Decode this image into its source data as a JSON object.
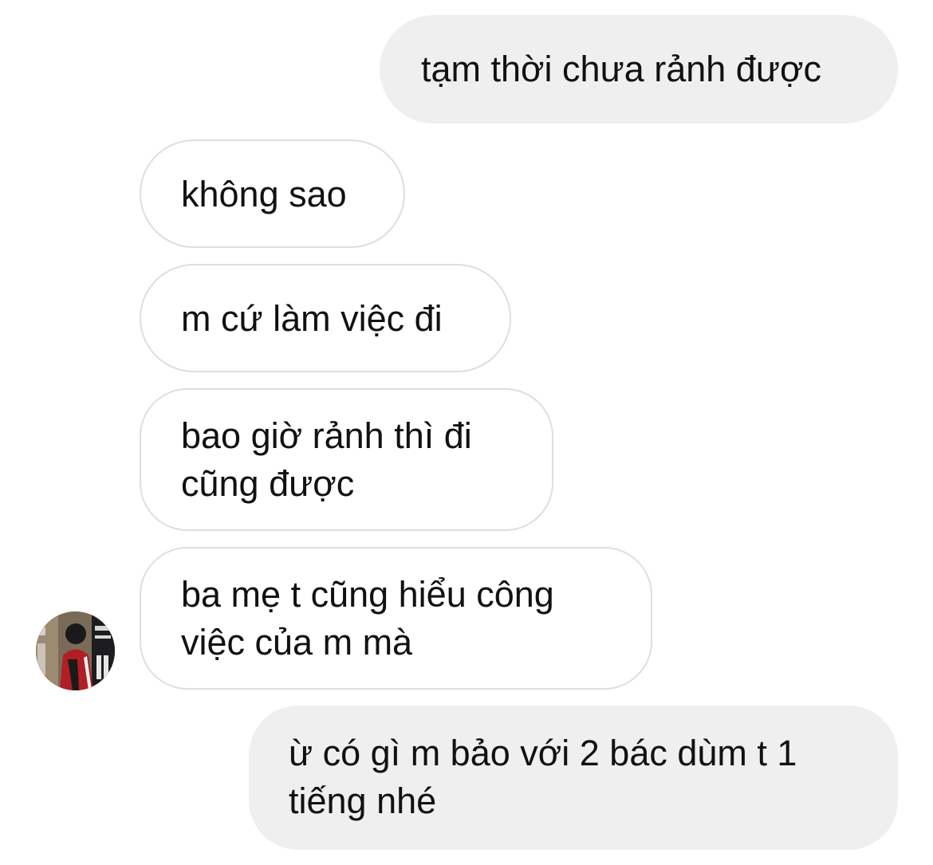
{
  "messages": [
    {
      "sender": "me",
      "lines": [
        "tạm thời chưa rảnh được"
      ]
    },
    {
      "sender": "contact",
      "lines": [
        "không sao"
      ]
    },
    {
      "sender": "contact",
      "lines": [
        "m cứ làm việc đi"
      ]
    },
    {
      "sender": "contact",
      "lines": [
        "bao giờ rảnh thì đi",
        "cũng được"
      ]
    },
    {
      "sender": "contact",
      "lines": [
        "ba mẹ t cũng hiểu công",
        "việc của m mà"
      ]
    },
    {
      "sender": "me",
      "lines": [
        "ừ có gì m bảo với 2 bác dùm t 1",
        "tiếng nhé"
      ]
    }
  ],
  "colors": {
    "sent_bubble": "#efefef",
    "received_border": "#dedede",
    "text": "#111111"
  }
}
